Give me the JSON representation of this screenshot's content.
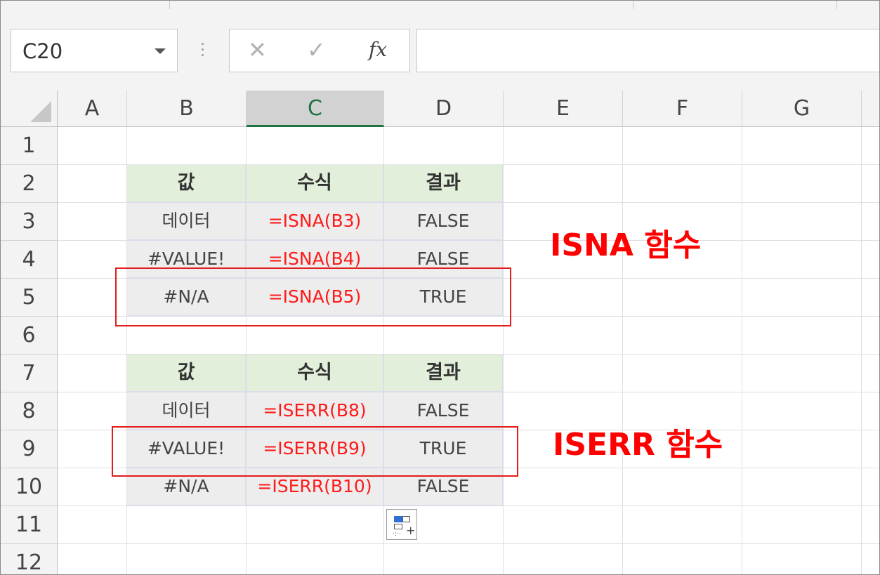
{
  "formula_bar": {
    "name_box": "C20",
    "cancel_glyph": "✕",
    "enter_glyph": "✓",
    "fx_label": "fx",
    "formula_value": ""
  },
  "columns": [
    "A",
    "B",
    "C",
    "D",
    "E",
    "F",
    "G"
  ],
  "active_column": "C",
  "rows": [
    "1",
    "2",
    "3",
    "4",
    "5",
    "6",
    "7",
    "8",
    "9",
    "10",
    "11",
    "12"
  ],
  "table1": {
    "headers": [
      "값",
      "수식",
      "결과"
    ],
    "rows": [
      [
        "데이터",
        "=ISNA(B3)",
        "FALSE"
      ],
      [
        "#VALUE!",
        "=ISNA(B4)",
        "FALSE"
      ],
      [
        "#N/A",
        "=ISNA(B5)",
        "TRUE"
      ]
    ]
  },
  "table2": {
    "headers": [
      "값",
      "수식",
      "결과"
    ],
    "rows": [
      [
        "데이터",
        "=ISERR(B8)",
        "FALSE"
      ],
      [
        "#VALUE!",
        "=ISERR(B9)",
        "TRUE"
      ],
      [
        "#N/A",
        "=ISERR(B10)",
        "FALSE"
      ]
    ]
  },
  "annotations": {
    "isna_label": "ISNA 함수",
    "iserr_label": "ISERR 함수"
  },
  "colors": {
    "header_fill": "#e2efda",
    "data_fill": "#ededed",
    "formula_text": "#ff1a1a",
    "annotation_red": "#ff0000",
    "active_column_accent": "#217346"
  },
  "icons": {
    "quick_analysis": "quick-analysis-icon",
    "select_all": "select-all-corner-icon",
    "name_box_dropdown": "chevron-down-icon"
  }
}
